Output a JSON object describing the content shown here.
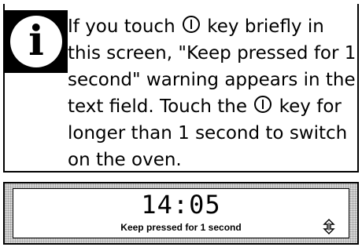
{
  "info": {
    "icon": "info-icon",
    "icon_letter": "i",
    "text_before_key": "If you touch ",
    "text_after_first_key": " key briefly in this screen, \"Keep pressed for 1 second\" warning appears in the text field. Touch the ",
    "text_after_second_key": " key for longer than 1 second to switch on the oven.",
    "key_icon": "power-icon"
  },
  "display": {
    "time": "14:05",
    "warning": "Keep pressed for 1 second",
    "scroll_icon": "up-down-arrow-icon"
  }
}
